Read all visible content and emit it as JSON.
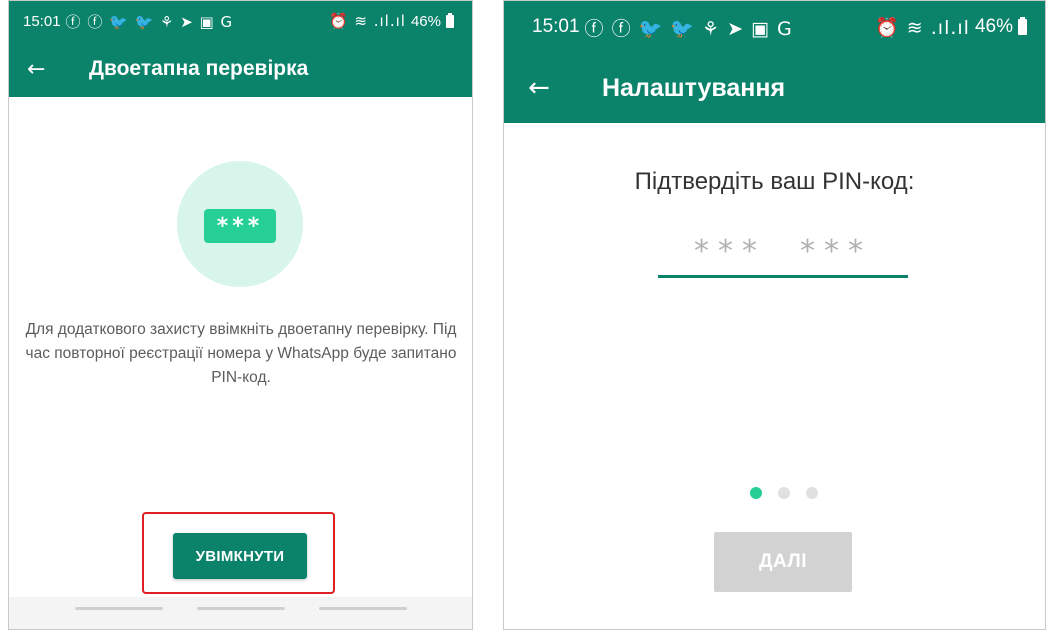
{
  "colors": {
    "accent": "#0b826a",
    "badge": "#25cf95",
    "circle": "#d7f5ea",
    "highlight": "#e02020",
    "disabled": "#d2d2d2"
  },
  "status_bar": {
    "time": "15:01",
    "notification_glyphs": "ⓕ ⓕ 🐦 🐦 ⚘ ➤ ▣ G",
    "system_glyphs": "⏰ ≋ .ıl.ıl",
    "battery": "46%"
  },
  "screen1": {
    "back_icon": "arrow-left-icon",
    "title": "Двоетапна перевірка",
    "pin_badge": "***",
    "description": "Для додаткового захисту ввімкніть двоетапну перевірку. Під час повторної реєстрації номера у WhatsApp буде запитано PIN-код.",
    "enable_button": "УВІМКНУТИ"
  },
  "screen2": {
    "back_icon": "arrow-left-icon",
    "title": "Налаштування",
    "prompt": "Підтвердіть ваш PIN-код:",
    "pin_group_1": "***",
    "pin_group_2": "***",
    "next_button": "ДАЛІ"
  }
}
